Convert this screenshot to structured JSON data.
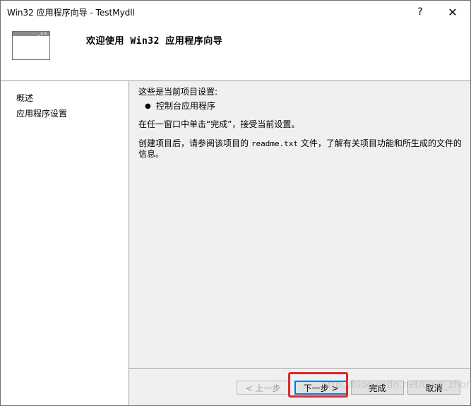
{
  "window": {
    "title": "Win32 应用程序向导 - TestMydll",
    "help_label": "?",
    "close_label": "✕"
  },
  "header": {
    "title": "欢迎使用 Win32 应用程序向导",
    "icon": "wizard-window-icon"
  },
  "sidebar": {
    "items": [
      {
        "label": "概述"
      },
      {
        "label": "应用程序设置"
      }
    ]
  },
  "content": {
    "intro": "这些是当前项目设置:",
    "bullet": "控制台应用程序",
    "finish_hint": "在任一窗口中单击“完成”，接受当前设置。",
    "readme_before": "创建项目后，请参阅该项目的 ",
    "readme_file": "readme.txt",
    "readme_after": " 文件，了解有关项目功能和所生成的文件的信息。"
  },
  "buttons": {
    "prev": "< 上一步",
    "next": "下一步 >",
    "finish": "完成",
    "cancel": "取消"
  },
  "watermark": "http://blog.csdn.net/qing_zhong",
  "colors": {
    "highlight": "#e0262b",
    "focus": "#0078d7"
  }
}
